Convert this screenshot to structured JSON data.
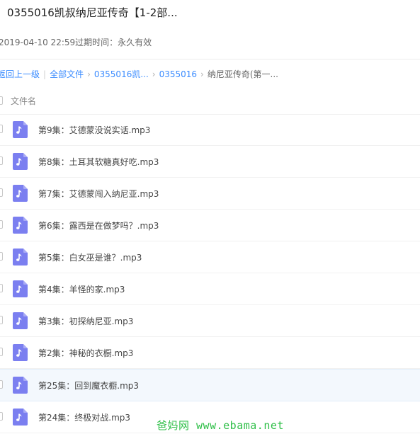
{
  "title": "0355016凯叔纳尼亚传奇【1-2部...",
  "meta": {
    "date": "2019-04-10 22:59",
    "expire_label": "过期时间：",
    "expire_value": "永久有效"
  },
  "breadcrumb": {
    "back": "返回上一级",
    "all_files": "全部文件",
    "level1": "0355016凯...",
    "level2": "0355016",
    "current": "纳尼亚传奇(第一..."
  },
  "list": {
    "column_name": "文件名",
    "file_icon": "music-note-icon",
    "icon_color": "#7b7ff0",
    "highlight_color": "#f3f8fd",
    "files": [
      {
        "name": "第9集：艾德蒙没说实话.mp3",
        "highlighted": false
      },
      {
        "name": "第8集：土耳其软糖真好吃.mp3",
        "highlighted": false
      },
      {
        "name": "第7集：艾德蒙闯入纳尼亚.mp3",
        "highlighted": false
      },
      {
        "name": "第6集：露西是在做梦吗？.mp3",
        "highlighted": false
      },
      {
        "name": "第5集：白女巫是谁？.mp3",
        "highlighted": false
      },
      {
        "name": "第4集：羊怪的家.mp3",
        "highlighted": false
      },
      {
        "name": "第3集：初探纳尼亚.mp3",
        "highlighted": false
      },
      {
        "name": "第2集：神秘的衣橱.mp3",
        "highlighted": false
      },
      {
        "name": "第25集：回到魔衣橱.mp3",
        "highlighted": true
      },
      {
        "name": "第24集：终极对战.mp3",
        "highlighted": false
      }
    ]
  },
  "watermark": "爸妈网 www.ebama.net"
}
